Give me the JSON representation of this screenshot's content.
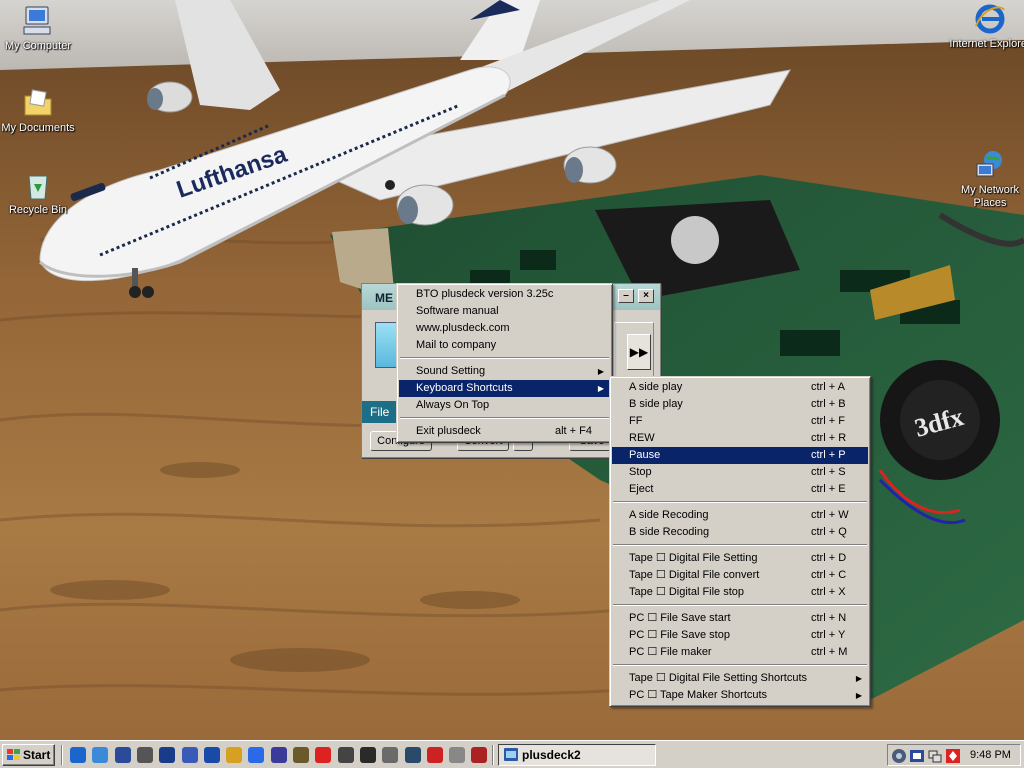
{
  "desktop": {
    "icons": [
      {
        "label": "My Computer"
      },
      {
        "label": "My Documents"
      },
      {
        "label": "Recycle Bin"
      },
      {
        "label": "Internet Explorer"
      },
      {
        "label": "My Network Places"
      }
    ],
    "wallpaper": {
      "airplane_livery": "Lufthansa",
      "card_logo": "3dfx"
    }
  },
  "app": {
    "title": "ME",
    "file_label": "File",
    "buttons": [
      "Configure",
      "Convert",
      "Save"
    ],
    "ff_icon": "fast-forward-icon"
  },
  "main_menu": {
    "items": [
      {
        "label": "BTO plusdeck version 3.25c"
      },
      {
        "label": "Software manual"
      },
      {
        "label": "www.plusdeck.com"
      },
      {
        "label": "Mail to company"
      },
      {
        "separator": true
      },
      {
        "label": "Sound Setting",
        "submenu": true
      },
      {
        "label": "Keyboard Shortcuts",
        "submenu": true,
        "highlighted": true
      },
      {
        "label": "Always On Top"
      },
      {
        "separator": true
      },
      {
        "label": "Exit plusdeck",
        "shortcut": "alt + F4"
      }
    ]
  },
  "sub_menu": {
    "items": [
      {
        "label": "A side play",
        "shortcut": "ctrl + A"
      },
      {
        "label": "B side play",
        "shortcut": "ctrl + B"
      },
      {
        "label": "FF",
        "shortcut": "ctrl + F"
      },
      {
        "label": "REW",
        "shortcut": "ctrl + R"
      },
      {
        "label": "Pause",
        "shortcut": "ctrl + P",
        "highlighted": true
      },
      {
        "label": "Stop",
        "shortcut": "ctrl + S"
      },
      {
        "label": "Eject",
        "shortcut": "ctrl + E"
      },
      {
        "separator": true
      },
      {
        "label": "A side Recoding",
        "shortcut": "ctrl + W"
      },
      {
        "label": "B side Recoding",
        "shortcut": "ctrl + Q"
      },
      {
        "separator": true
      },
      {
        "label": "Tape ☐ Digital File Setting",
        "shortcut": "ctrl + D"
      },
      {
        "label": "Tape ☐ Digital File convert",
        "shortcut": "ctrl + C"
      },
      {
        "label": "Tape ☐ Digital File stop",
        "shortcut": "ctrl + X"
      },
      {
        "separator": true
      },
      {
        "label": "PC ☐ File Save start",
        "shortcut": "ctrl + N"
      },
      {
        "label": "PC ☐ File Save stop",
        "shortcut": "ctrl + Y"
      },
      {
        "label": "PC ☐ File maker",
        "shortcut": "ctrl + M"
      },
      {
        "separator": true
      },
      {
        "label": "Tape ☐ Digital File Setting Shortcuts",
        "submenu": true
      },
      {
        "label": "PC ☐ Tape Maker Shortcuts",
        "submenu": true
      }
    ]
  },
  "taskbar": {
    "start_label": "Start",
    "task_label": "plusdeck2",
    "clock": "9:48 PM",
    "quick_launch": [
      "ie-icon",
      "outlook-express-icon",
      "media-player-icon",
      "app-icon-1",
      "app-icon-2",
      "app-icon-3",
      "app-icon-4",
      "app-icon-5",
      "app-icon-6",
      "app-icon-7",
      "app-icon-8",
      "app-icon-9",
      "app-icon-10",
      "app-icon-11",
      "app-icon-12",
      "app-icon-13",
      "app-icon-14",
      "app-icon-15",
      "app-icon-16"
    ],
    "tray_icons": [
      "volume-icon",
      "messenger-icon",
      "network-icon",
      "security-icon"
    ]
  },
  "colors": {
    "menu_bg": "#d4d0c8",
    "menu_highlight": "#0a246a",
    "app_filebar": "#1c6f86"
  }
}
